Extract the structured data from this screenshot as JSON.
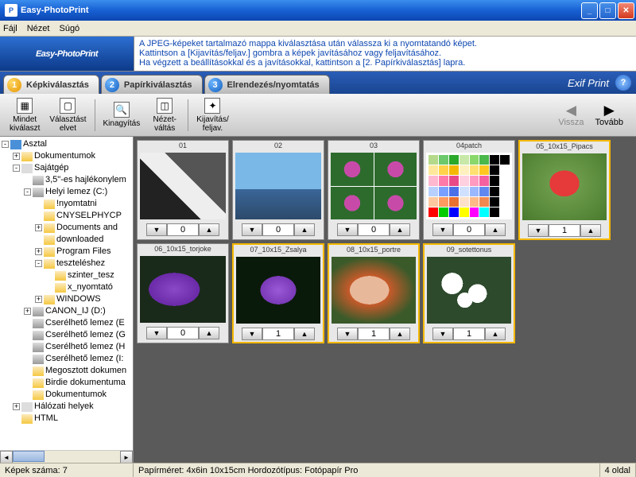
{
  "window": {
    "title": "Easy-PhotoPrint"
  },
  "menu": {
    "file": "Fájl",
    "view": "Nézet",
    "help": "Súgó"
  },
  "info": {
    "line1": "A JPEG-képeket tartalmazó mappa kiválasztása után válassza ki a nyomtatandó képet.",
    "line2": "Kattintson a [Kijavítás/feljav.] gombra a képek javításához vagy feljavításához.",
    "line3": "Ha végzett a beállításokkal és a javításokkal, kattintson a [2. Papírkiválasztás] lapra."
  },
  "logo": {
    "top": "Easy-",
    "bottom": "PhotoPrint"
  },
  "tabs": {
    "t1": "Képkiválasztás",
    "t2": "Papírkiválasztás",
    "t3": "Elrendezés/nyomtatás"
  },
  "exif": "Exif Print",
  "toolbar": {
    "select_all": "Mindet\nkiválaszt",
    "deselect_all": "Választást\nelvet",
    "zoom": "Kinagyítás",
    "view_switch": "Nézet-\nváltás",
    "correct": "Kijavítás/\nfeljav.",
    "back": "Vissza",
    "next": "Tovább"
  },
  "tree": {
    "root": "Asztal",
    "items": [
      "Dokumentumok",
      "Sajátgép",
      "3,5\"-es hajlékonylem",
      "Helyi lemez (C:)",
      "!nyomtatni",
      "CNYSELPHYCP",
      "Documents and",
      "downloaded",
      "Program Files",
      "teszteléshez",
      "szinter_tesz",
      "x_nyomtató",
      "WINDOWS",
      "CANON_IJ (D:)",
      "Cserélhető lemez (E",
      "Cserélhető lemez (G",
      "Cserélhető lemez (H",
      "Cserélhető lemez (I:",
      "Megosztott dokumen",
      "Birdie dokumentuma",
      "Dokumentumok",
      "Hálózati helyek",
      "HTML"
    ]
  },
  "thumbs": [
    {
      "name": "01",
      "count": 0,
      "cls": "img-bw",
      "selected": false
    },
    {
      "name": "02",
      "count": 0,
      "cls": "img-sky",
      "selected": false
    },
    {
      "name": "03",
      "count": 0,
      "cls": "img-flower4",
      "selected": false
    },
    {
      "name": "04patch",
      "count": 0,
      "cls": "img-patch",
      "selected": false
    },
    {
      "name": "05_10x15_Pipacs",
      "count": 1,
      "cls": "img-poppy",
      "selected": true
    },
    {
      "name": "06_10x15_torjoke",
      "count": 0,
      "cls": "img-purple1",
      "selected": false
    },
    {
      "name": "07_10x15_Zsalya",
      "count": 1,
      "cls": "img-purple2",
      "selected": true
    },
    {
      "name": "08_10x15_portre",
      "count": 1,
      "cls": "img-portrait",
      "selected": true
    },
    {
      "name": "09_sotettonus",
      "count": 1,
      "cls": "img-white",
      "selected": true
    }
  ],
  "status": {
    "count_label": "Képek száma: 7",
    "paper": "Papírméret: 4x6in 10x15cm  Hordozótípus: Fotópapír Pro",
    "pages": "4 oldal"
  },
  "patch_colors": [
    "#b5d98a",
    "#6bc96b",
    "#2aa82a",
    "#c8e8a8",
    "#8ad86b",
    "#4ab84a",
    "#000",
    "#000",
    "#ffe89b",
    "#ffd24a",
    "#f5b800",
    "#fff0c0",
    "#ffe070",
    "#ffc820",
    "#000",
    "#fff",
    "#ffb8d0",
    "#ff7aa8",
    "#e84a88",
    "#ffd0e0",
    "#ff9ac0",
    "#f560a0",
    "#000",
    "#fff",
    "#b8d0ff",
    "#7aa0ff",
    "#4a70e8",
    "#d0e0ff",
    "#9ab8ff",
    "#6088f0",
    "#000",
    "#fff",
    "#ffc8a0",
    "#ff9a60",
    "#e87030",
    "#ffe0c8",
    "#ffb888",
    "#f08850",
    "#000",
    "#fff",
    "#f00",
    "#0c0",
    "#00f",
    "#ff0",
    "#f0f",
    "#0ff",
    "#000",
    "#fff"
  ]
}
